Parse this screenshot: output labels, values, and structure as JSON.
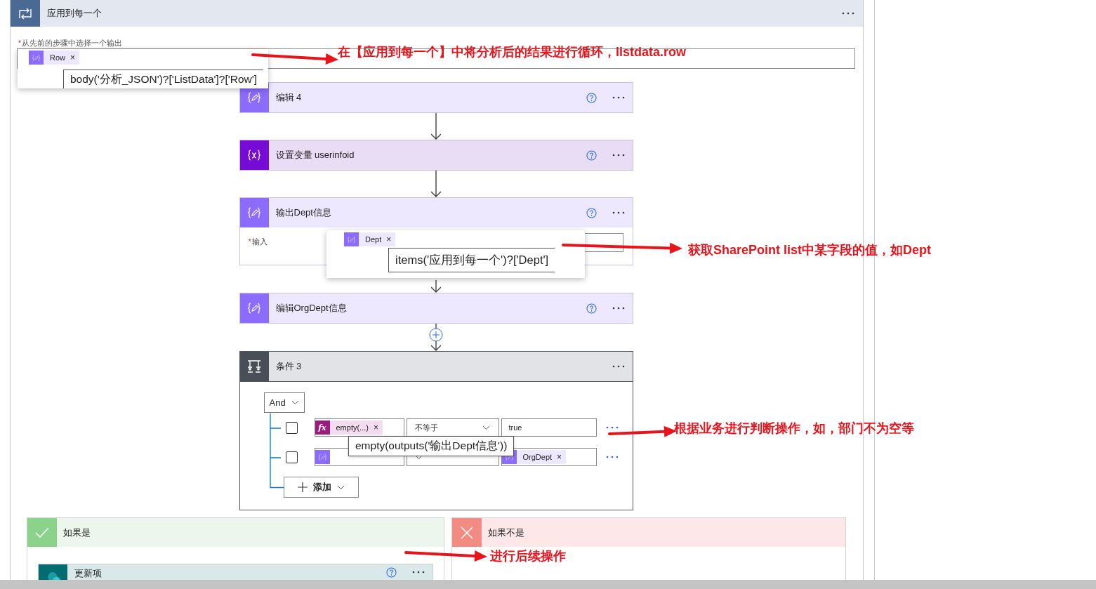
{
  "loop": {
    "title": "应用到每一个",
    "required_mark": "*",
    "field_label": "从先前的步骤中选择一个输出",
    "token": {
      "label": "Row",
      "remove": "×"
    },
    "tooltip": "body('分析_JSON')?['ListData']?['Row']"
  },
  "actions": [
    {
      "kind": "compose",
      "title": "编辑 4"
    },
    {
      "kind": "variable",
      "title": "设置变量 userinfoid"
    },
    {
      "kind": "compose",
      "title": "输出Dept信息",
      "input": {
        "required_mark": "*",
        "label": "输入",
        "token": {
          "label": "Dept",
          "remove": "×"
        },
        "tooltip": "items('应用到每一个')?['Dept']"
      }
    },
    {
      "kind": "compose",
      "title": "编辑OrgDept信息"
    }
  ],
  "condition": {
    "title": "条件 3",
    "group_operator": "And",
    "rows": [
      {
        "checked": false,
        "left": {
          "kind": "expression",
          "icon": "fx",
          "label": "empty(...)",
          "remove": "×"
        },
        "operator": "不等于",
        "right": {
          "kind": "text",
          "value": "true"
        }
      },
      {
        "checked": false,
        "left": {
          "kind": "dynamic"
        },
        "right": {
          "kind": "dynamic",
          "label": "OrgDept",
          "remove": "×"
        }
      }
    ],
    "add_label": "添加",
    "tooltip": "empty(outputs('输出Dept信息'))"
  },
  "branches": [
    {
      "kind": "yes",
      "title": "如果是",
      "steps": [
        {
          "kind": "sharepoint",
          "title": "更新项"
        }
      ]
    },
    {
      "kind": "no",
      "title": "如果不是"
    }
  ],
  "annotations": [
    "在【应用到每一个】中将分析后的结果进行循环，listdata.row",
    "获取SharePoint list中某字段的值，如Dept",
    "根据业务进行判断操作，如，部门不为空等",
    "进行后续操作"
  ]
}
